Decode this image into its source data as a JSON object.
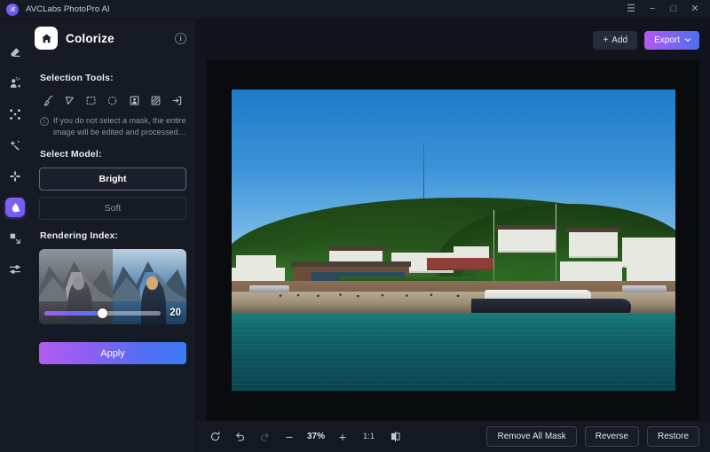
{
  "titlebar": {
    "app_name": "AVCLabs PhotoPro AI",
    "logo_icon": "avclabs-logo-icon",
    "controls": [
      {
        "name": "menu-button",
        "icon": "hamburger-menu-icon",
        "glyph": "☰"
      },
      {
        "name": "minimize-button",
        "icon": "minimize-icon",
        "glyph": "−"
      },
      {
        "name": "maximize-button",
        "icon": "maximize-icon",
        "glyph": "□"
      },
      {
        "name": "close-button",
        "icon": "close-icon",
        "glyph": "✕"
      }
    ]
  },
  "rail": {
    "items": [
      {
        "name": "sidebar-item-retouch",
        "icon": "eraser-icon",
        "active": false
      },
      {
        "name": "sidebar-item-background",
        "icon": "person-cutout-icon",
        "active": false
      },
      {
        "name": "sidebar-item-upscale",
        "icon": "expand-arrows-icon",
        "active": false
      },
      {
        "name": "sidebar-item-enhance",
        "icon": "magic-wand-icon",
        "active": false
      },
      {
        "name": "sidebar-item-denoise",
        "icon": "four-petal-icon",
        "active": false
      },
      {
        "name": "sidebar-item-colorize",
        "icon": "colorize-drop-icon",
        "active": true
      },
      {
        "name": "sidebar-item-resize",
        "icon": "resize-corner-icon",
        "active": false
      },
      {
        "name": "sidebar-item-adjust",
        "icon": "sliders-icon",
        "active": false
      }
    ]
  },
  "panel": {
    "home_icon": "home-icon",
    "title": "Colorize",
    "info_icon": "info-icon",
    "info_glyph": "i",
    "selection_tools_label": "Selection Tools:",
    "tools": [
      {
        "name": "tool-brush",
        "icon": "brush-icon"
      },
      {
        "name": "tool-magic-wand",
        "icon": "cursor-wand-icon"
      },
      {
        "name": "tool-rectangle-select",
        "icon": "rectangle-select-icon"
      },
      {
        "name": "tool-ellipse-select",
        "icon": "ellipse-select-icon"
      },
      {
        "name": "tool-subject-select",
        "icon": "portrait-select-icon"
      },
      {
        "name": "tool-pattern-select",
        "icon": "hatched-square-icon"
      },
      {
        "name": "tool-import-mask",
        "icon": "arrow-into-box-icon"
      }
    ],
    "hint_icon": "info-icon",
    "hint_glyph": "i",
    "hint_text": "If you do not select a mask, the entire image will be edited and processed…",
    "select_model_label": "Select Model:",
    "models": [
      {
        "name": "model-option-bright",
        "label": "Bright",
        "selected": true
      },
      {
        "name": "model-option-soft",
        "label": "Soft",
        "selected": false
      }
    ],
    "rendering_index_label": "Rendering Index:",
    "rendering_index_value": "20",
    "rendering_index_percent": 50,
    "apply_label": "Apply"
  },
  "main": {
    "add_label": "Add",
    "add_icon": "plus-icon",
    "add_glyph": "+",
    "export_label": "Export",
    "export_caret_icon": "chevron-down-icon",
    "export_caret_glyph": "⌄"
  },
  "bottombar": {
    "reset_icon": "refresh-icon",
    "undo_icon": "undo-arrow-icon",
    "redo_icon": "redo-arrow-icon",
    "zoom_out_icon": "minus-icon",
    "zoom_out_glyph": "−",
    "zoom_value": "37%",
    "zoom_in_icon": "plus-icon",
    "zoom_in_glyph": "+",
    "actual_size_label": "1:1",
    "compare_icon": "split-compare-icon",
    "buttons": [
      {
        "name": "remove-all-mask-button",
        "label": "Remove All Mask"
      },
      {
        "name": "reverse-button",
        "label": "Reverse"
      },
      {
        "name": "restore-button",
        "label": "Restore"
      }
    ]
  },
  "colors": {
    "accent_purple": "#8a63f2",
    "accent_blue": "#3b7af2",
    "panel_bg": "#161a24",
    "canvas_bg": "#090b0f",
    "app_bg": "#11141c"
  }
}
